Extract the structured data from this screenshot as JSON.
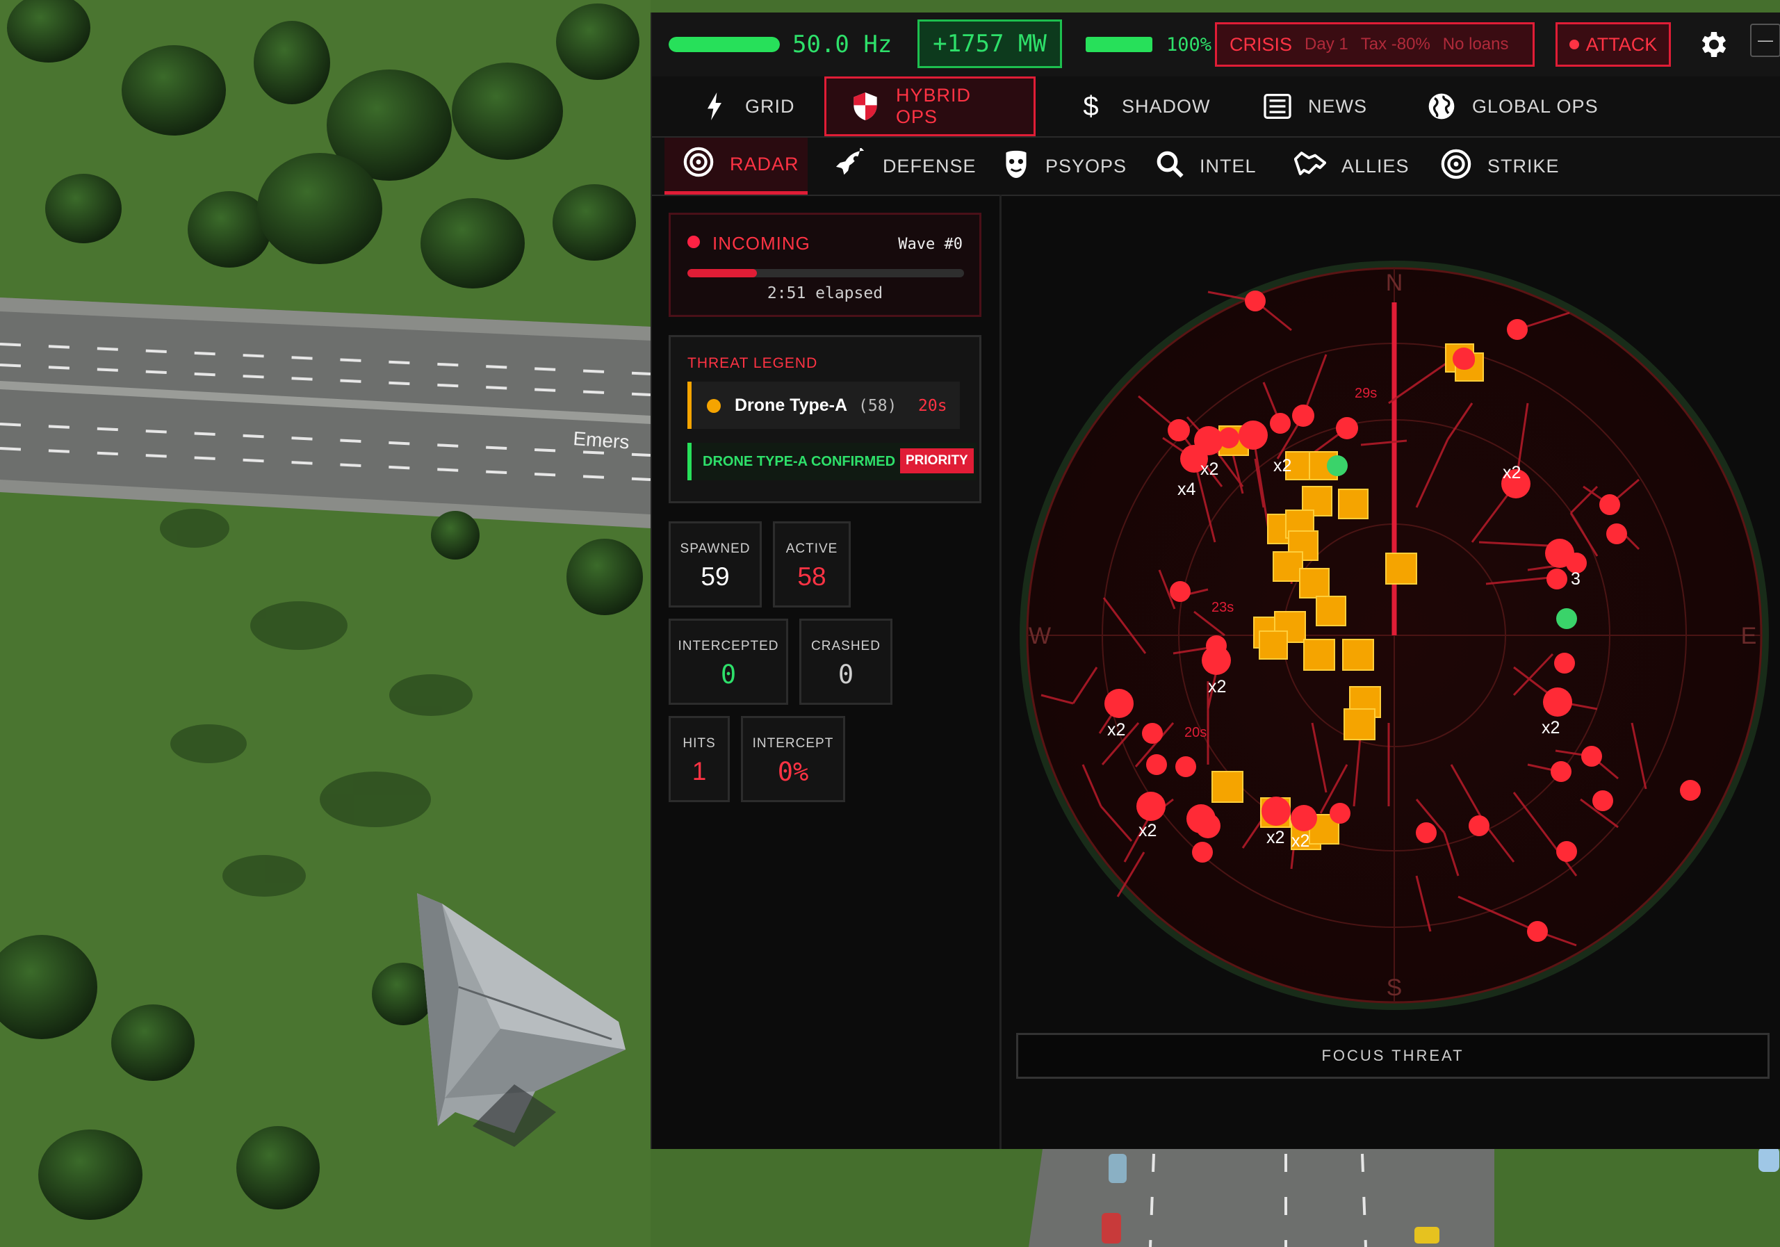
{
  "topbar": {
    "frequency": "50.0 Hz",
    "frequency_fill": 1.0,
    "power": "+1757 MW",
    "stability_percent": "100%",
    "stability_fill": 1.0,
    "crisis_label": "CRISIS",
    "crisis_day": "Day 1",
    "crisis_tax": "Tax -80%",
    "crisis_loans": "No loans",
    "attack_label": "ATTACK",
    "minimize_label": "—"
  },
  "main_tabs": [
    {
      "label": "GRID",
      "icon": "lightning-icon"
    },
    {
      "label": "HYBRID OPS",
      "icon": "shield-icon",
      "active": true
    },
    {
      "label": "SHADOW",
      "icon": "dollar-icon"
    },
    {
      "label": "NEWS",
      "icon": "newspaper-icon"
    },
    {
      "label": "GLOBAL OPS",
      "icon": "globe-icon"
    }
  ],
  "sub_tabs": [
    {
      "label": "RADAR",
      "icon": "target-icon",
      "active": true
    },
    {
      "label": "DEFENSE",
      "icon": "rocket-icon"
    },
    {
      "label": "PSYOPS",
      "icon": "mask-icon"
    },
    {
      "label": "INTEL",
      "icon": "search-icon"
    },
    {
      "label": "ALLIES",
      "icon": "handshake-icon"
    },
    {
      "label": "STRIKE",
      "icon": "crosshair-icon"
    }
  ],
  "incoming": {
    "label": "INCOMING",
    "wave": "Wave #0",
    "progress": 0.25,
    "elapsed": "2:51 elapsed"
  },
  "legend": {
    "title": "THREAT LEGEND",
    "entry_name": "Drone Type-A",
    "entry_count": "(58)",
    "entry_time": "20s",
    "confirmed": "DRONE TYPE-A CONFIRMED",
    "priority": "PRIORITY"
  },
  "stats": {
    "spawned_label": "SPAWNED",
    "spawned": "59",
    "active_label": "ACTIVE",
    "active": "58",
    "intercepted_label": "INTERCEPTED",
    "intercepted": "0",
    "crashed_label": "CRASHED",
    "crashed": "0",
    "hits_label": "HITS",
    "hits": "1",
    "intercept_label": "INTERCEPT",
    "intercept": "0%"
  },
  "radar": {
    "compass": {
      "n": "N",
      "e": "E",
      "s": "S",
      "w": "W"
    },
    "labels": [
      "29s",
      "23s",
      "20s",
      "x2",
      "x4",
      "3"
    ],
    "focus_label": "FOCUS THREAT"
  },
  "world": {
    "road_sign": "Emers"
  },
  "colors": {
    "accent_red": "#e01d36",
    "ok_green": "#27e05a",
    "threat_orange": "#f5a400",
    "radar_bg": "#1a0707"
  }
}
